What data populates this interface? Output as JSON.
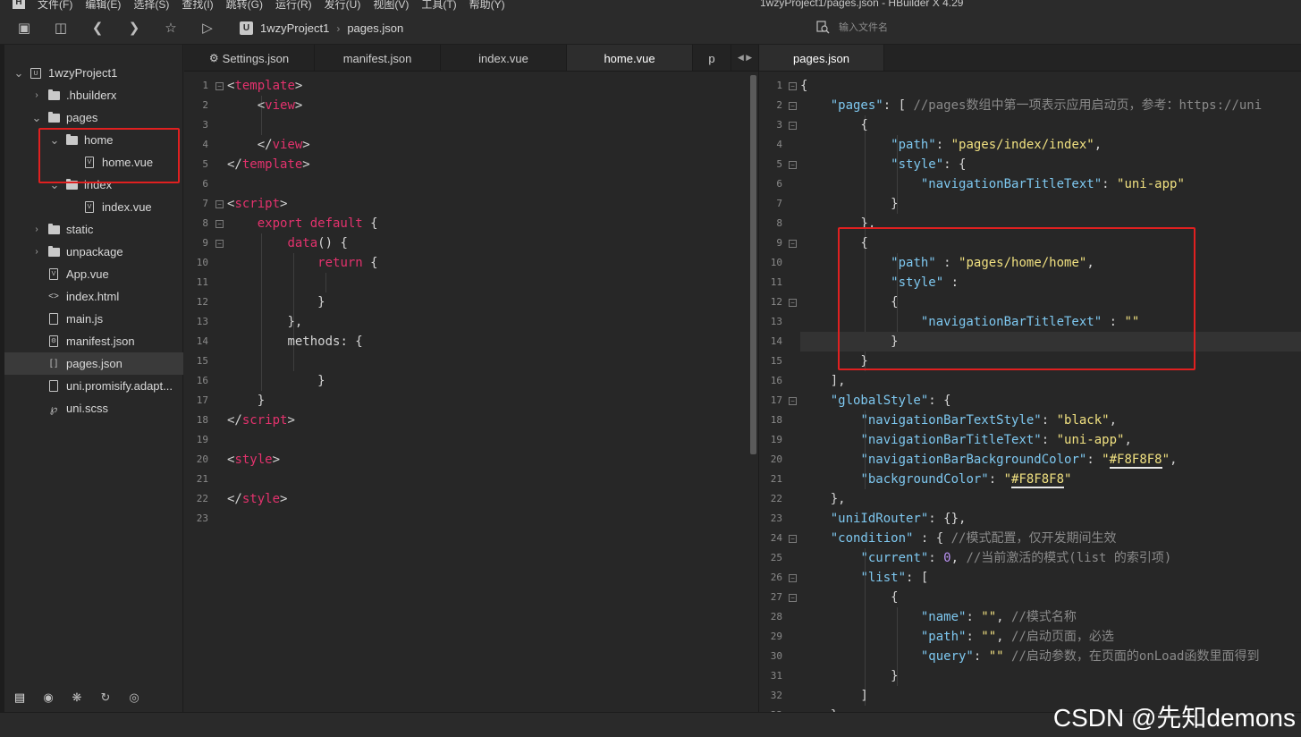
{
  "window": {
    "title": "1wzyProject1/pages.json - HBuilder X 4.29",
    "menu": [
      "文件(F)",
      "编辑(E)",
      "选择(S)",
      "查找(I)",
      "跳转(G)",
      "运行(R)",
      "发行(U)",
      "视图(V)",
      "工具(T)",
      "帮助(Y)"
    ]
  },
  "toolbar": {
    "icons": [
      "new-file-icon",
      "save-icon",
      "back-icon",
      "forward-icon",
      "star-icon",
      "run-icon"
    ],
    "breadcrumb": {
      "project_badge": "U",
      "project": "1wzyProject1",
      "file": "pages.json"
    },
    "search_placeholder": "输入文件名"
  },
  "sidebar": {
    "items": [
      {
        "label": "1wzyProject1",
        "type": "project",
        "depth": 0,
        "expanded": true
      },
      {
        "label": ".hbuilderx",
        "type": "folder",
        "depth": 1,
        "expanded": false
      },
      {
        "label": "pages",
        "type": "folder",
        "depth": 1,
        "expanded": true
      },
      {
        "label": "home",
        "type": "folder",
        "depth": 2,
        "expanded": true
      },
      {
        "label": "home.vue",
        "type": "vue",
        "depth": 3
      },
      {
        "label": "index",
        "type": "folder",
        "depth": 2,
        "expanded": true
      },
      {
        "label": "index.vue",
        "type": "vue",
        "depth": 3
      },
      {
        "label": "static",
        "type": "folder",
        "depth": 1,
        "expanded": false
      },
      {
        "label": "unpackage",
        "type": "folder",
        "depth": 1,
        "expanded": false
      },
      {
        "label": "App.vue",
        "type": "vue",
        "depth": 1
      },
      {
        "label": "index.html",
        "type": "html",
        "depth": 1
      },
      {
        "label": "main.js",
        "type": "file",
        "depth": 1
      },
      {
        "label": "manifest.json",
        "type": "manifest",
        "depth": 1
      },
      {
        "label": "pages.json",
        "type": "json",
        "depth": 1,
        "selected": true
      },
      {
        "label": "uni.promisify.adapt...",
        "type": "file",
        "depth": 1
      },
      {
        "label": "uni.scss",
        "type": "scss",
        "depth": 1
      }
    ],
    "bottom_icons": [
      "project-manager-icon",
      "plugin-icon",
      "debug-icon",
      "source-control-icon",
      "browser-icon"
    ]
  },
  "left_editor": {
    "tabs": [
      {
        "label": "Settings.json",
        "icon": "gear-icon"
      },
      {
        "label": "manifest.json"
      },
      {
        "label": "index.vue"
      },
      {
        "label": "home.vue",
        "active": true
      },
      {
        "label": "p"
      }
    ],
    "lines": [
      [
        [
          "<",
          "br"
        ],
        [
          "template",
          "tag"
        ],
        [
          ">",
          "br"
        ]
      ],
      [
        [
          "    ",
          "plain"
        ],
        [
          "<",
          "br"
        ],
        [
          "view",
          "tag"
        ],
        [
          ">",
          "br"
        ]
      ],
      [],
      [
        [
          "    ",
          "plain"
        ],
        [
          "</",
          "br"
        ],
        [
          "view",
          "tag"
        ],
        [
          ">",
          "br"
        ]
      ],
      [
        [
          "</",
          "br"
        ],
        [
          "template",
          "tag"
        ],
        [
          ">",
          "br"
        ]
      ],
      [],
      [
        [
          "<",
          "br"
        ],
        [
          "script",
          "tag"
        ],
        [
          ">",
          "br"
        ]
      ],
      [
        [
          "    ",
          "plain"
        ],
        [
          "export default",
          "key"
        ],
        [
          " {",
          "plain"
        ]
      ],
      [
        [
          "        ",
          "plain"
        ],
        [
          "data",
          "fn"
        ],
        [
          "() {",
          "plain"
        ]
      ],
      [
        [
          "            ",
          "plain"
        ],
        [
          "return",
          "key"
        ],
        [
          " {",
          "plain"
        ]
      ],
      [],
      [
        [
          "            ",
          "plain"
        ],
        [
          "}",
          "plain"
        ]
      ],
      [
        [
          "        ",
          "plain"
        ],
        [
          "},",
          "plain"
        ]
      ],
      [
        [
          "        ",
          "plain"
        ],
        [
          "methods: {",
          "plain"
        ]
      ],
      [],
      [
        [
          "            ",
          "plain"
        ],
        [
          "}",
          "plain"
        ]
      ],
      [
        [
          "    ",
          "plain"
        ],
        [
          "}",
          "plain"
        ]
      ],
      [
        [
          "</",
          "br"
        ],
        [
          "script",
          "tag"
        ],
        [
          ">",
          "br"
        ]
      ],
      [],
      [
        [
          "<",
          "br"
        ],
        [
          "style",
          "tag"
        ],
        [
          ">",
          "br"
        ]
      ],
      [],
      [
        [
          "</",
          "br"
        ],
        [
          "style",
          "tag"
        ],
        [
          ">",
          "br"
        ]
      ],
      []
    ],
    "folds": [
      1,
      7,
      8,
      9
    ]
  },
  "right_editor": {
    "tabs": [
      {
        "label": "pages.json",
        "active": true
      }
    ],
    "lines": [
      [
        [
          "{",
          "pun"
        ]
      ],
      [
        [
          "    ",
          "pun"
        ],
        [
          "\"pages\"",
          "key"
        ],
        [
          ": [ ",
          "pun"
        ],
        [
          "//pages数组中第一项表示应用启动页，参考：https://uni",
          "cmt"
        ]
      ],
      [
        [
          "        {",
          "pun"
        ]
      ],
      [
        [
          "            ",
          "pun"
        ],
        [
          "\"path\"",
          "key"
        ],
        [
          ": ",
          "pun"
        ],
        [
          "\"pages/index/index\"",
          "str"
        ],
        [
          ",",
          "pun"
        ]
      ],
      [
        [
          "            ",
          "pun"
        ],
        [
          "\"style\"",
          "key"
        ],
        [
          ": {",
          "pun"
        ]
      ],
      [
        [
          "                ",
          "pun"
        ],
        [
          "\"navigationBarTitleText\"",
          "key"
        ],
        [
          ": ",
          "pun"
        ],
        [
          "\"uni-app\"",
          "str"
        ]
      ],
      [
        [
          "            }",
          "pun"
        ]
      ],
      [
        [
          "        },",
          "pun"
        ]
      ],
      [
        [
          "        {",
          "pun"
        ]
      ],
      [
        [
          "            ",
          "pun"
        ],
        [
          "\"path\"",
          "key"
        ],
        [
          " : ",
          "pun"
        ],
        [
          "\"pages/home/home\"",
          "str"
        ],
        [
          ",",
          "pun"
        ]
      ],
      [
        [
          "            ",
          "pun"
        ],
        [
          "\"style\"",
          "key"
        ],
        [
          " :",
          "pun"
        ]
      ],
      [
        [
          "            {",
          "pun"
        ]
      ],
      [
        [
          "                ",
          "pun"
        ],
        [
          "\"navigationBarTitleText\"",
          "key"
        ],
        [
          " : ",
          "pun"
        ],
        [
          "\"\"",
          "str"
        ]
      ],
      [
        [
          "            }",
          "pun"
        ]
      ],
      [
        [
          "        }",
          "pun"
        ]
      ],
      [
        [
          "    ],",
          "pun"
        ]
      ],
      [
        [
          "    ",
          "pun"
        ],
        [
          "\"globalStyle\"",
          "key"
        ],
        [
          ": {",
          "pun"
        ]
      ],
      [
        [
          "        ",
          "pun"
        ],
        [
          "\"navigationBarTextStyle\"",
          "key"
        ],
        [
          ": ",
          "pun"
        ],
        [
          "\"black\"",
          "str"
        ],
        [
          ",",
          "pun"
        ]
      ],
      [
        [
          "        ",
          "pun"
        ],
        [
          "\"navigationBarTitleText\"",
          "key"
        ],
        [
          ": ",
          "pun"
        ],
        [
          "\"uni-app\"",
          "str"
        ],
        [
          ",",
          "pun"
        ]
      ],
      [
        [
          "        ",
          "pun"
        ],
        [
          "\"navigationBarBackgroundColor\"",
          "key"
        ],
        [
          ": ",
          "pun"
        ],
        [
          "\"",
          "str"
        ],
        [
          "#F8F8F8",
          "color"
        ],
        [
          "\"",
          "str"
        ],
        [
          ",",
          "pun"
        ]
      ],
      [
        [
          "        ",
          "pun"
        ],
        [
          "\"backgroundColor\"",
          "key"
        ],
        [
          ": ",
          "pun"
        ],
        [
          "\"",
          "str"
        ],
        [
          "#F8F8F8",
          "color"
        ],
        [
          "\"",
          "str"
        ]
      ],
      [
        [
          "    },",
          "pun"
        ]
      ],
      [
        [
          "    ",
          "pun"
        ],
        [
          "\"uniIdRouter\"",
          "key"
        ],
        [
          ": {},",
          "pun"
        ]
      ],
      [
        [
          "    ",
          "pun"
        ],
        [
          "\"condition\"",
          "key"
        ],
        [
          " : { ",
          "pun"
        ],
        [
          "//模式配置，仅开发期间生效",
          "cmt"
        ]
      ],
      [
        [
          "        ",
          "pun"
        ],
        [
          "\"current\"",
          "key"
        ],
        [
          ": ",
          "pun"
        ],
        [
          "0",
          "num"
        ],
        [
          ", ",
          "pun"
        ],
        [
          "//当前激活的模式(list 的索引项)",
          "cmt"
        ]
      ],
      [
        [
          "        ",
          "pun"
        ],
        [
          "\"list\"",
          "key"
        ],
        [
          ": [",
          "pun"
        ]
      ],
      [
        [
          "            {",
          "pun"
        ]
      ],
      [
        [
          "                ",
          "pun"
        ],
        [
          "\"name\"",
          "key"
        ],
        [
          ": ",
          "pun"
        ],
        [
          "\"\"",
          "str"
        ],
        [
          ", ",
          "pun"
        ],
        [
          "//模式名称",
          "cmt"
        ]
      ],
      [
        [
          "                ",
          "pun"
        ],
        [
          "\"path\"",
          "key"
        ],
        [
          ": ",
          "pun"
        ],
        [
          "\"\"",
          "str"
        ],
        [
          ", ",
          "pun"
        ],
        [
          "//启动页面，必选",
          "cmt"
        ]
      ],
      [
        [
          "                ",
          "pun"
        ],
        [
          "\"query\"",
          "key"
        ],
        [
          ": ",
          "pun"
        ],
        [
          "\"\"",
          "str"
        ],
        [
          " ",
          "pun"
        ],
        [
          "//启动参数，在页面的onLoad函数里面得到",
          "cmt"
        ]
      ],
      [
        [
          "            }",
          "pun"
        ]
      ],
      [
        [
          "        ]",
          "pun"
        ]
      ],
      [
        [
          "    }",
          "pun"
        ]
      ]
    ],
    "folds": [
      1,
      2,
      3,
      5,
      9,
      12,
      17,
      24,
      26,
      27
    ],
    "current_line": 14
  },
  "watermark": "CSDN @先知demons",
  "colors": {
    "highlight_box": "#e02020",
    "json_key": "#7ec8f0",
    "json_string": "#f0e080",
    "tag": "#e3326d"
  }
}
